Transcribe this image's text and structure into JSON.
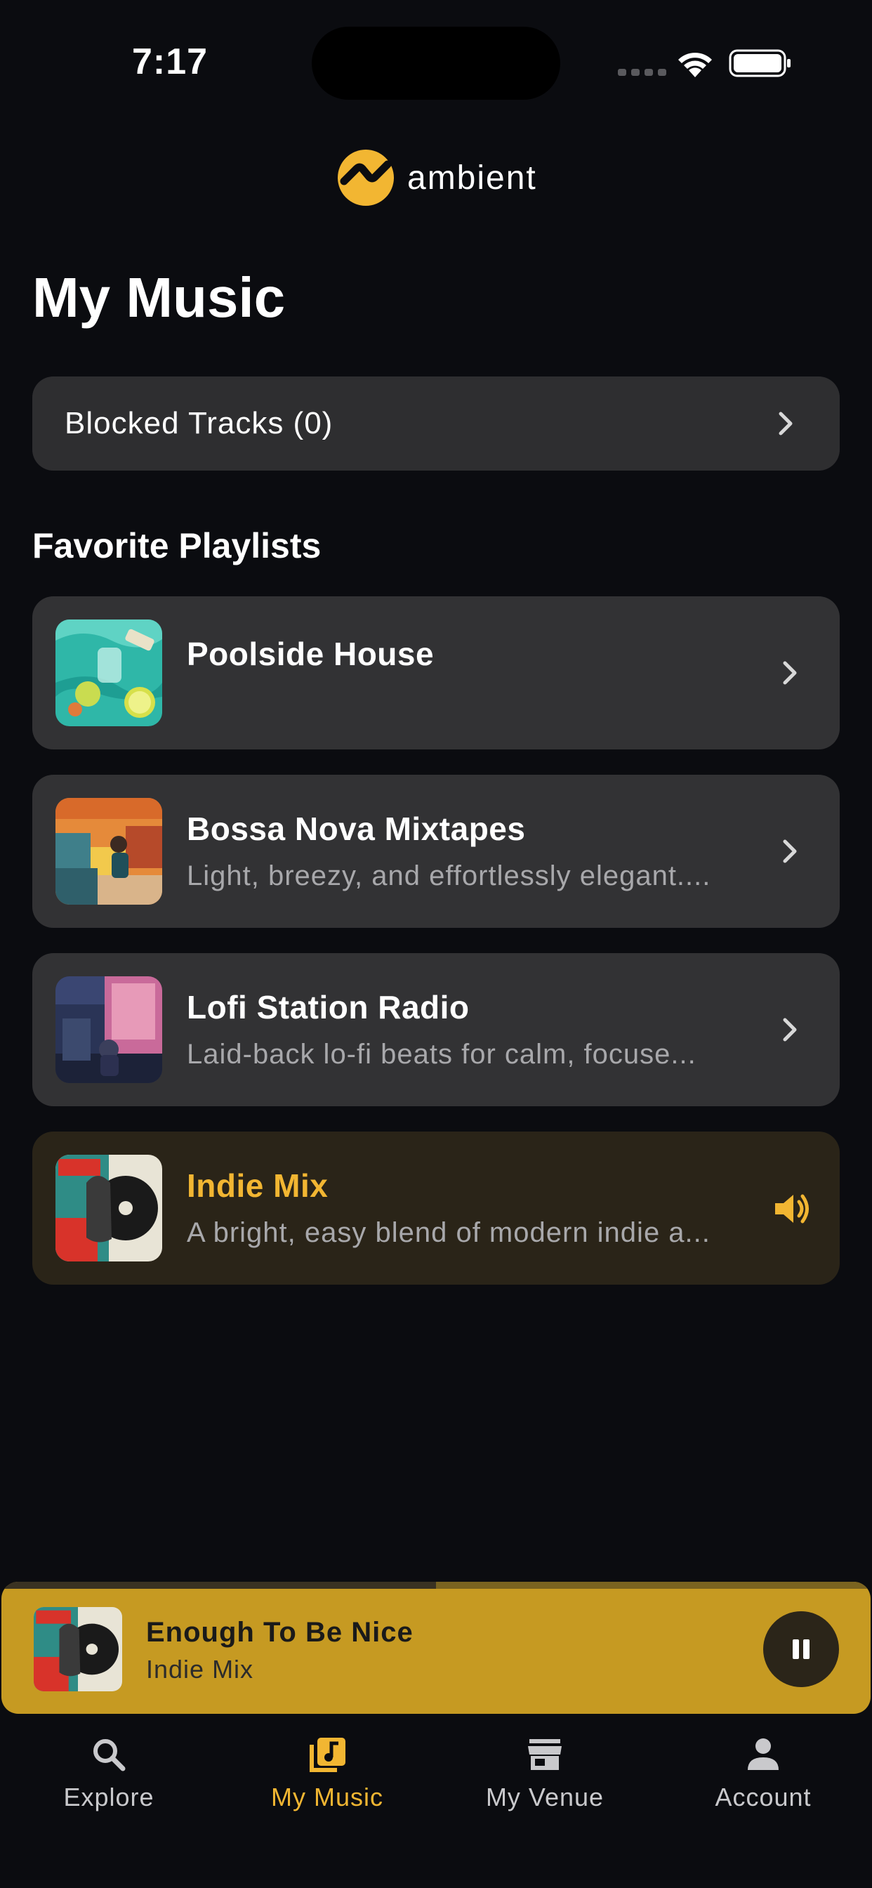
{
  "status_bar": {
    "time": "7:17"
  },
  "brand": {
    "name": "ambient",
    "accent": "#f2b632"
  },
  "page_title": "My Music",
  "blocked_tracks": {
    "label": "Blocked Tracks (0)"
  },
  "favorites": {
    "title": "Favorite Playlists",
    "playlists": [
      {
        "name": "Poolside House",
        "description": ""
      },
      {
        "name": "Bossa Nova Mixtapes",
        "description": "Light, breezy, and effortlessly elegant...."
      },
      {
        "name": "Lofi Station Radio",
        "description": "Laid-back lo-fi beats for calm, focuse..."
      },
      {
        "name": "Indie Mix",
        "description": "A bright, easy blend of modern indie a...",
        "now_playing": true
      }
    ]
  },
  "now_playing": {
    "track": "Enough To Be Nice",
    "playlist": "Indie Mix",
    "progress": 0.5,
    "bar_color": "#c69a22"
  },
  "tabs": [
    {
      "label": "Explore",
      "icon": "search-icon"
    },
    {
      "label": "My Music",
      "icon": "music-library-icon",
      "active": true
    },
    {
      "label": "My Venue",
      "icon": "storefront-icon"
    },
    {
      "label": "Account",
      "icon": "person-icon"
    }
  ]
}
